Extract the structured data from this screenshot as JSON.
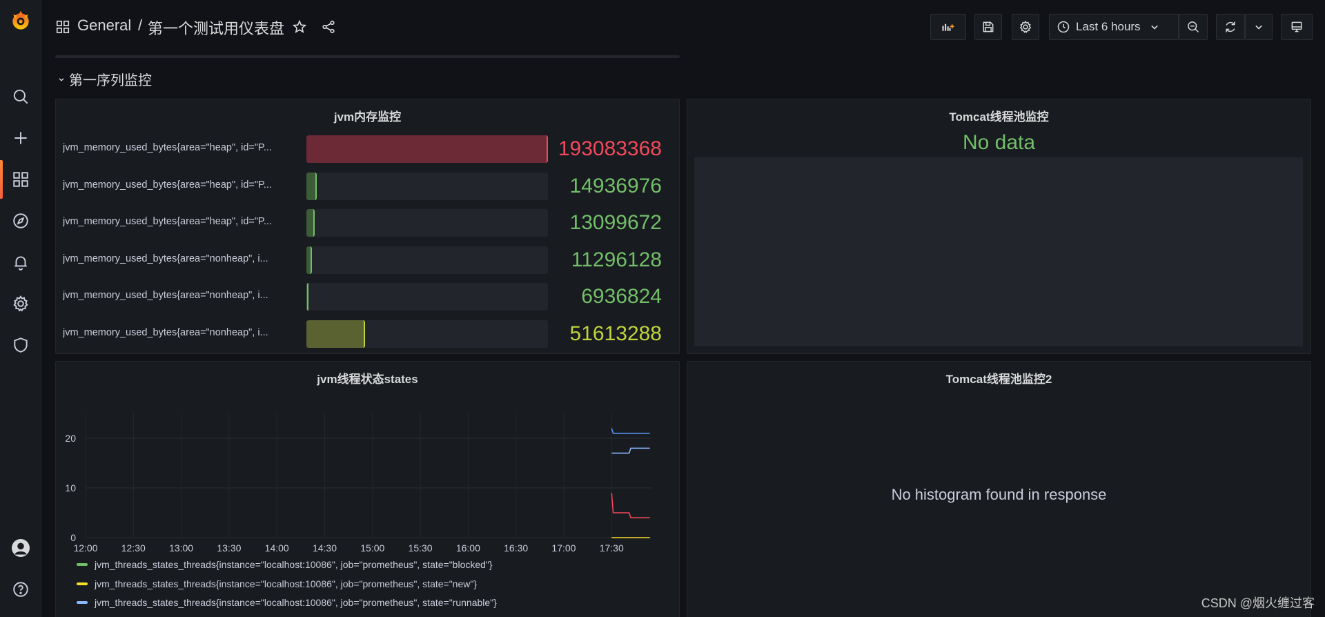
{
  "header": {
    "folder": "General",
    "separator": "/",
    "dashboard_title": "第一个测试用仪表盘",
    "time_range": "Last 6 hours"
  },
  "sidebar": {
    "items": [
      {
        "name": "search-icon"
      },
      {
        "name": "plus-icon"
      },
      {
        "name": "dashboards-icon"
      },
      {
        "name": "explore-icon"
      },
      {
        "name": "alerting-icon"
      },
      {
        "name": "configuration-icon"
      },
      {
        "name": "shield-icon"
      },
      {
        "name": "avatar"
      },
      {
        "name": "help-icon"
      }
    ]
  },
  "row": {
    "title": "第一序列监控"
  },
  "panels": {
    "jvm_memory": {
      "title": "jvm内存监控",
      "items": [
        {
          "label": "jvm_memory_used_bytes{area=\"heap\", id=\"P...",
          "value": "193083368",
          "fill": 1.0,
          "color": "#f2495c",
          "bg": "#6b2a35"
        },
        {
          "label": "jvm_memory_used_bytes{area=\"heap\", id=\"P...",
          "value": "14936976",
          "fill": 0.044,
          "color": "#73bf69",
          "bg": "#3b5c37"
        },
        {
          "label": "jvm_memory_used_bytes{area=\"heap\", id=\"P...",
          "value": "13099672",
          "fill": 0.034,
          "color": "#73bf69",
          "bg": "#3b5c37"
        },
        {
          "label": "jvm_memory_used_bytes{area=\"nonheap\", i...",
          "value": "11296128",
          "fill": 0.024,
          "color": "#73bf69",
          "bg": "#3b5c37"
        },
        {
          "label": "jvm_memory_used_bytes{area=\"nonheap\", i...",
          "value": "6936824",
          "fill": 0.005,
          "color": "#73bf69",
          "bg": "#3b5c37"
        },
        {
          "label": "jvm_memory_used_bytes{area=\"nonheap\", i...",
          "value": "51613288",
          "fill": 0.243,
          "color": "#c0d33c",
          "bg": "#5a6232"
        }
      ]
    },
    "tomcat_pool": {
      "title": "Tomcat线程池监控",
      "nodata": "No data"
    },
    "jvm_threads": {
      "title": "jvm线程状态states"
    },
    "tomcat_pool2": {
      "title": "Tomcat线程池监控2",
      "message": "No histogram found in response"
    }
  },
  "chart_data": {
    "type": "line",
    "title": "jvm线程状态states",
    "x_ticks": [
      "12:00",
      "12:30",
      "13:00",
      "13:30",
      "14:00",
      "14:30",
      "15:00",
      "15:30",
      "16:00",
      "16:30",
      "17:00",
      "17:30"
    ],
    "y_ticks": [
      "0",
      "10",
      "20"
    ],
    "ylim": [
      0,
      25
    ],
    "grid": true,
    "legend_placement": "bottom",
    "series": [
      {
        "name": "jvm_threads_states_threads{instance=\"localhost:10086\", job=\"prometheus\", state=\"blocked\"}",
        "color": "#73bf69",
        "x": [
          "17:30",
          "17:54"
        ],
        "values": [
          0,
          0
        ],
        "show_line": false
      },
      {
        "name": "jvm_threads_states_threads{instance=\"localhost:10086\", job=\"prometheus\", state=\"new\"}",
        "color": "#fade2a",
        "x": [
          "17:30",
          "17:54"
        ],
        "values": [
          0,
          0
        ],
        "show_line": true
      },
      {
        "name": "jvm_threads_states_threads{instance=\"localhost:10086\", job=\"prometheus\", state=\"runnable\"}",
        "color": "#8ab8ff",
        "x": [
          "17:30",
          "17:31",
          "17:41",
          "17:42",
          "17:54"
        ],
        "values": [
          17,
          17,
          17,
          18,
          18
        ],
        "show_line": true
      }
    ],
    "extra_lines": [
      {
        "color": "#5794f2",
        "x": [
          "17:30",
          "17:31",
          "17:54"
        ],
        "values": [
          22,
          21,
          21
        ]
      },
      {
        "color": "#f2495c",
        "x": [
          "17:30",
          "17:31",
          "17:41",
          "17:42",
          "17:54"
        ],
        "values": [
          9,
          5,
          5,
          4,
          4
        ]
      }
    ]
  },
  "watermark": "CSDN @烟火缠过客"
}
